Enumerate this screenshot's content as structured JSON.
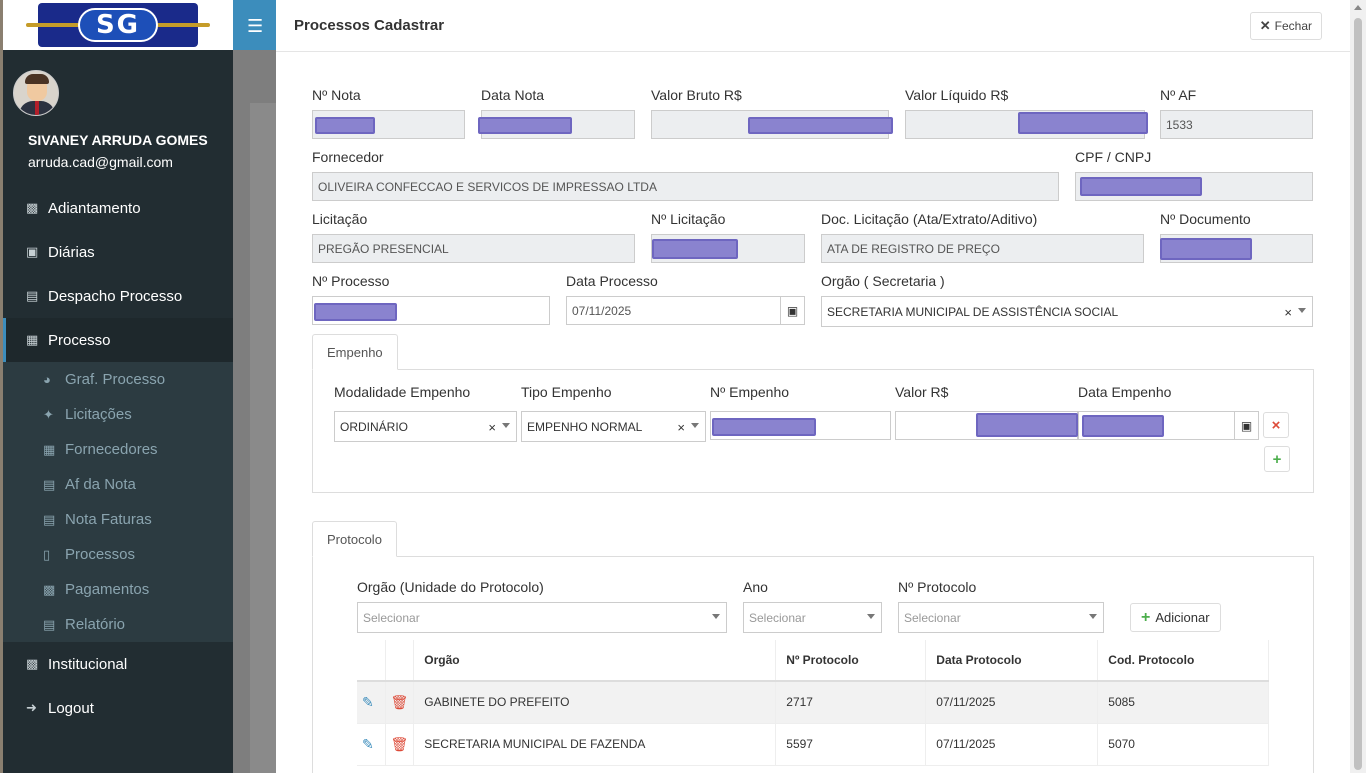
{
  "brand": {
    "logo_text": "SG"
  },
  "user": {
    "name": "SIVANEY ARRUDA GOMES",
    "email": "arruda.cad@gmail.com"
  },
  "menu": [
    {
      "label": "Adiantamento",
      "icon": "money-icon"
    },
    {
      "label": "Diárias",
      "icon": "briefcase-icon"
    },
    {
      "label": "Despacho Processo",
      "icon": "file-icon"
    },
    {
      "label": "Processo",
      "icon": "id-card-icon",
      "active": true
    },
    {
      "label": "Institucional",
      "icon": "building-icon"
    },
    {
      "label": "Logout",
      "icon": "sign-out-icon"
    }
  ],
  "submenu": [
    {
      "label": "Graf. Processo",
      "icon": "pie-chart-icon"
    },
    {
      "label": "Licitações",
      "icon": "gavel-icon"
    },
    {
      "label": "Fornecedores",
      "icon": "id-card-icon"
    },
    {
      "label": "Af da Nota",
      "icon": "file-text-icon"
    },
    {
      "label": "Nota Faturas",
      "icon": "file-text-icon"
    },
    {
      "label": "Processos",
      "icon": "folder-open-icon"
    },
    {
      "label": "Pagamentos",
      "icon": "money-icon"
    },
    {
      "label": "Relatório",
      "icon": "clipboard-icon"
    }
  ],
  "modal": {
    "title": "Processos Cadastrar",
    "close_label": "Fechar",
    "fields": {
      "nota_label": "Nº Nota",
      "data_nota_label": "Data Nota",
      "valor_bruto_label": "Valor Bruto R$",
      "valor_liquido_label": "Valor Líquido R$",
      "af_label": "Nº AF",
      "af_value": "1533",
      "fornecedor_label": "Fornecedor",
      "fornecedor_value": "OLIVEIRA CONFECCAO E SERVICOS DE IMPRESSAO LTDA",
      "cpf_label": "CPF / CNPJ",
      "licitacao_label": "Licitação",
      "licitacao_value": "PREGÃO PRESENCIAL",
      "n_licitacao_label": "Nº Licitação",
      "doc_licitacao_label": "Doc. Licitação (Ata/Extrato/Aditivo)",
      "doc_licitacao_value": "ATA DE REGISTRO DE PREÇO",
      "n_documento_label": "Nº Documento",
      "processo_label": "Nº Processo",
      "data_processo_label": "Data Processo",
      "data_processo_value": "07/11/2025",
      "orgao_label": "Orgão ( Secretaria )",
      "orgao_value": "SECRETARIA MUNICIPAL DE ASSISTÊNCIA SOCIAL"
    },
    "empenho": {
      "tab_label": "Empenho",
      "modalidade_label": "Modalidade Empenho",
      "modalidade_value": "ORDINÁRIO",
      "tipo_label": "Tipo Empenho",
      "tipo_value": "EMPENHO NORMAL",
      "n_empenho_label": "Nº Empenho",
      "valor_label": "Valor R$",
      "data_label": "Data Empenho"
    },
    "protocolo": {
      "tab_label": "Protocolo",
      "orgao_label": "Orgão (Unidade do Protocolo)",
      "orgao_placeholder": "Selecionar",
      "ano_label": "Ano",
      "ano_placeholder": "Selecionar",
      "n_label": "Nº Protocolo",
      "n_placeholder": "Selecionar",
      "add_label": "Adicionar",
      "columns": [
        "Orgão",
        "Nº Protocolo",
        "Data Protocolo",
        "Cod. Protocolo"
      ],
      "rows": [
        {
          "orgao": "GABINETE DO PREFEITO",
          "numero": "2717",
          "data": "07/11/2025",
          "codigo": "5085"
        },
        {
          "orgao": "SECRETARIA MUNICIPAL DE FAZENDA",
          "numero": "5597",
          "data": "07/11/2025",
          "codigo": "5070"
        }
      ]
    }
  },
  "colors": {
    "sidebar": "#222d32",
    "topbar": "#3c8dbc",
    "accent": "#3c8dbc",
    "danger": "#dd4b39",
    "success": "#4cae4c"
  }
}
